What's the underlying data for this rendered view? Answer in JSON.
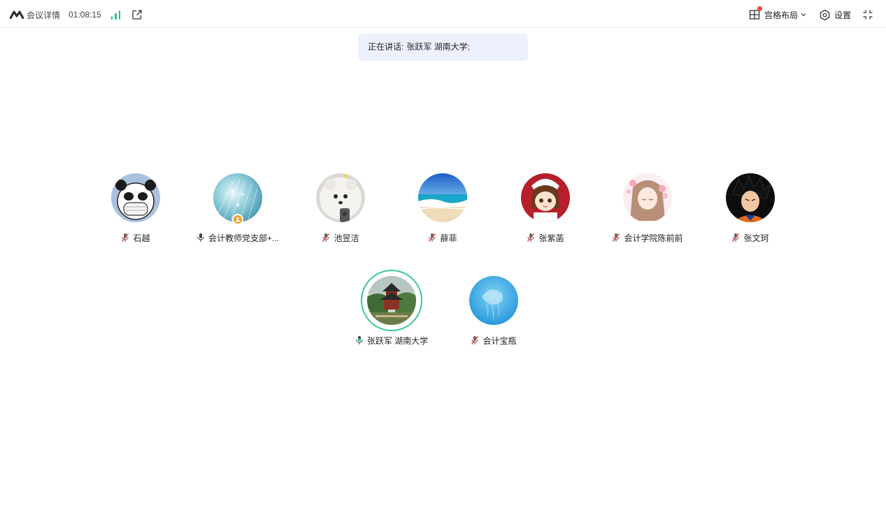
{
  "topbar": {
    "meeting_details_label": "会议详情",
    "timer": "01:08:15",
    "layout_label": "宫格布局",
    "settings_label": "设置"
  },
  "banner": {
    "prefix": "正在讲话:",
    "speaker": "张跃军 湖南大学;"
  },
  "participants": [
    {
      "name": "石越",
      "mic": "muted",
      "avatar": "panda-avatar"
    },
    {
      "name": "会计教师党支部+...",
      "mic": "on",
      "avatar": "fiber-optic-avatar",
      "badge": "host-badge-icon"
    },
    {
      "name": "池昱洁",
      "mic": "muted",
      "avatar": "pomeranian-avatar"
    },
    {
      "name": "薛菲",
      "mic": "muted",
      "avatar": "beach-avatar"
    },
    {
      "name": "张紫菡",
      "mic": "muted",
      "avatar": "anime-girl-avatar"
    },
    {
      "name": "会计学院陈前前",
      "mic": "muted",
      "avatar": "pink-flower-girl-avatar"
    },
    {
      "name": "张文珂",
      "mic": "muted",
      "avatar": "goku-avatar"
    },
    {
      "name": "张跃军 湖南大学",
      "mic": "speaking",
      "avatar": "pagoda-avatar"
    },
    {
      "name": "会计宝瓶",
      "mic": "muted",
      "avatar": "jellyfish-avatar"
    }
  ],
  "colors": {
    "accent_green": "#23c28a",
    "speaking_ring": "#3bc891",
    "banner_bg": "#edf1fd",
    "notification_dot": "#f0463a",
    "muted_red": "#e8433a"
  }
}
